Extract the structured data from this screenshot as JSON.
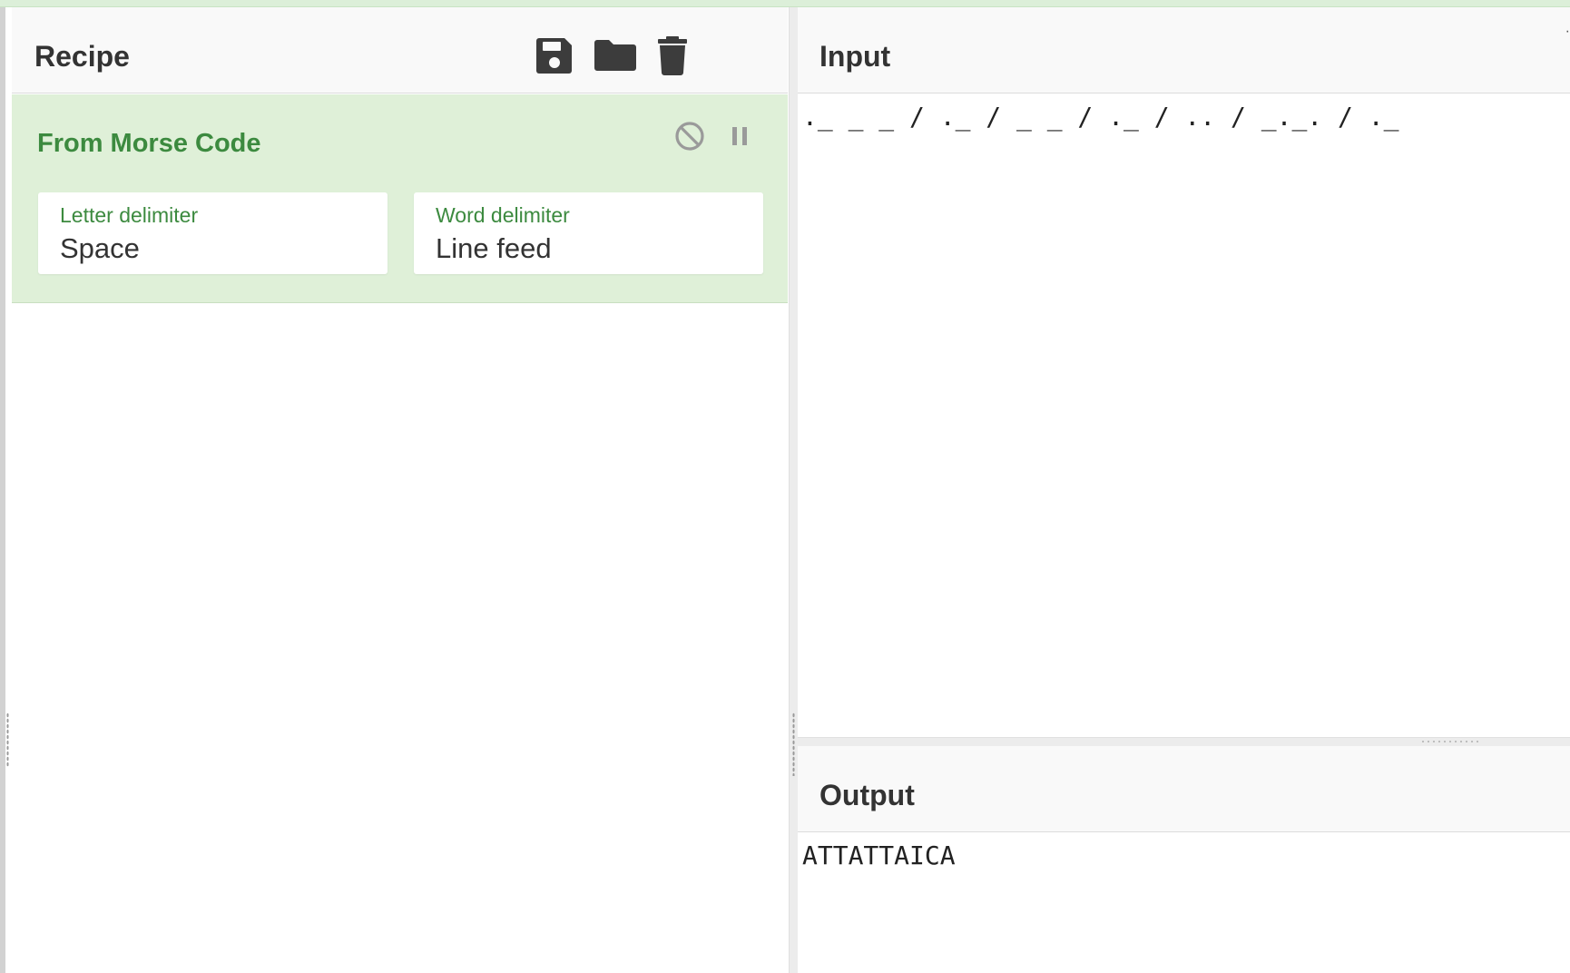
{
  "recipe": {
    "title": "Recipe",
    "icons": [
      "save-icon",
      "folder-open-icon",
      "trash-icon"
    ],
    "operation": {
      "name": "From Morse Code",
      "icons": [
        "disable-icon",
        "pause-icon"
      ],
      "args": [
        {
          "label": "Letter delimiter",
          "value": "Space"
        },
        {
          "label": "Word delimiter",
          "value": "Line feed"
        }
      ]
    }
  },
  "input": {
    "title": "Input",
    "text": "._ _ _ / ._ / _ _ / ._ / .. / _._. / ._"
  },
  "output": {
    "title": "Output",
    "text": "ATTATTAICA"
  },
  "colors": {
    "accent_green": "#3c8a3f",
    "operation_bg": "#dff0d8",
    "header_bg": "#f9f9f9",
    "icon_dark": "#3c3c3c",
    "icon_grey": "#9a9a9a"
  }
}
